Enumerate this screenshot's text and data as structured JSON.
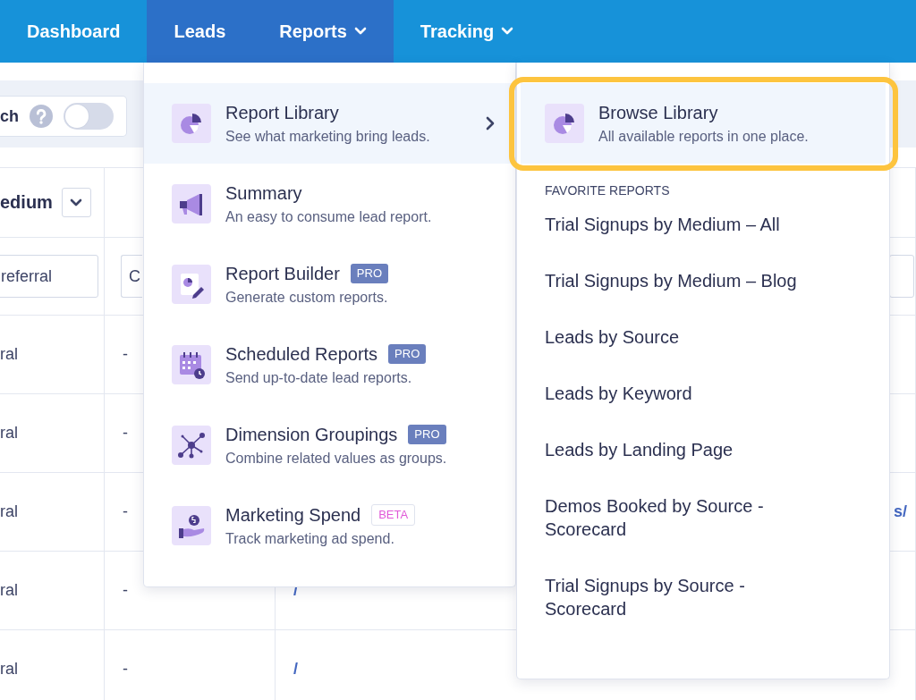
{
  "nav": {
    "items": [
      {
        "label": "Dashboard",
        "highlighted": false,
        "dropdown": false
      },
      {
        "label": "Leads",
        "highlighted": true,
        "dropdown": false
      },
      {
        "label": "Reports",
        "highlighted": true,
        "dropdown": true
      },
      {
        "label": "Tracking",
        "highlighted": false,
        "dropdown": true
      }
    ]
  },
  "toolbar": {
    "label": "ch",
    "toggle": {
      "on": false
    }
  },
  "table": {
    "header": {
      "column_1": "edium"
    },
    "filters": {
      "column_1": "referral",
      "column_2": "C"
    },
    "rows": [
      {
        "column_1": "ral",
        "column_2": "-"
      },
      {
        "column_1": "ral",
        "column_2": "-"
      },
      {
        "column_1": "ral",
        "column_2": "-",
        "column_4": "s/"
      },
      {
        "column_1": "ral",
        "column_2": "-",
        "column_3": "/"
      },
      {
        "column_1": "ral",
        "column_2": "-",
        "column_3": "/"
      }
    ]
  },
  "report_menu": {
    "items": [
      {
        "title": "Report Library",
        "description": "See what marketing bring leads.",
        "highlighted": true,
        "submenu": true
      },
      {
        "title": "Summary",
        "description": "An easy to consume lead report.",
        "highlighted": false,
        "submenu": false
      },
      {
        "title": "Report Builder",
        "description": "Generate custom reports.",
        "highlighted": false,
        "submenu": false,
        "badge": {
          "text": "PRO",
          "kind": "pro"
        }
      },
      {
        "title": "Scheduled Reports",
        "description": "Send up-to-date lead reports.",
        "highlighted": false,
        "submenu": false,
        "badge": {
          "text": "PRO",
          "kind": "pro"
        }
      },
      {
        "title": "Dimension Groupings",
        "description": "Combine related values as groups.",
        "highlighted": false,
        "submenu": false,
        "badge": {
          "text": "PRO",
          "kind": "pro"
        }
      },
      {
        "title": "Marketing Spend",
        "description": "Track marketing ad spend.",
        "highlighted": false,
        "submenu": false,
        "badge": {
          "text": "BETA",
          "kind": "beta"
        }
      }
    ]
  },
  "library_menu": {
    "featured": {
      "title": "Browse Library",
      "description": "All available reports in one place.",
      "highlighted": true
    },
    "section_title": "FAVORITE REPORTS",
    "items": [
      "Trial Signups by Medium – All",
      "Trial Signups by Medium – Blog",
      "Leads by Source",
      "Leads by Keyword",
      "Leads by Landing Page",
      "Demos Booked by Source - Scorecard",
      "Trial Signups by Source - Scorecard"
    ]
  }
}
